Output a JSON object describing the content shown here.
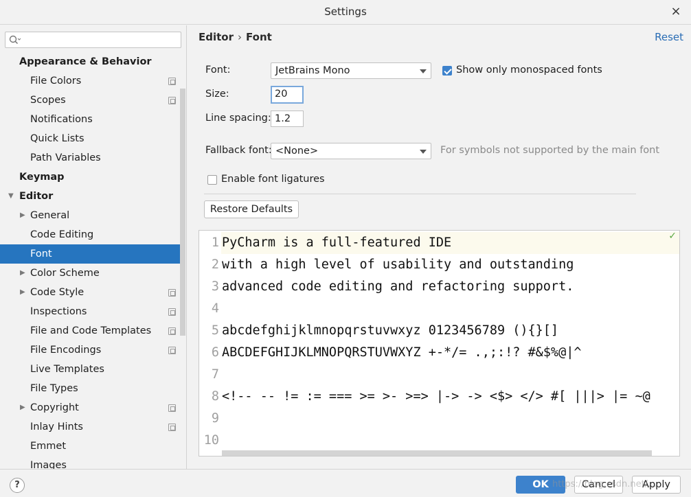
{
  "window": {
    "title": "Settings",
    "close_glyph": "×"
  },
  "sidebar": {
    "search": {
      "value": "",
      "placeholder": ""
    },
    "items": [
      {
        "label": "Appearance & Behavior",
        "level": 0,
        "bold": true,
        "arrow": "",
        "config": false
      },
      {
        "label": "File Colors",
        "level": 1,
        "bold": false,
        "arrow": "",
        "config": true
      },
      {
        "label": "Scopes",
        "level": 1,
        "bold": false,
        "arrow": "",
        "config": true
      },
      {
        "label": "Notifications",
        "level": 1,
        "bold": false,
        "arrow": "",
        "config": false
      },
      {
        "label": "Quick Lists",
        "level": 1,
        "bold": false,
        "arrow": "",
        "config": false
      },
      {
        "label": "Path Variables",
        "level": 1,
        "bold": false,
        "arrow": "",
        "config": false
      },
      {
        "label": "Keymap",
        "level": 0,
        "bold": true,
        "arrow": "",
        "config": false
      },
      {
        "label": "Editor",
        "level": 0,
        "bold": true,
        "arrow": "▼",
        "config": false
      },
      {
        "label": "General",
        "level": 1,
        "bold": false,
        "arrow": "▶",
        "config": false
      },
      {
        "label": "Code Editing",
        "level": 1,
        "bold": false,
        "arrow": "",
        "config": false
      },
      {
        "label": "Font",
        "level": 1,
        "bold": false,
        "arrow": "",
        "config": false,
        "selected": true
      },
      {
        "label": "Color Scheme",
        "level": 1,
        "bold": false,
        "arrow": "▶",
        "config": false
      },
      {
        "label": "Code Style",
        "level": 1,
        "bold": false,
        "arrow": "▶",
        "config": true
      },
      {
        "label": "Inspections",
        "level": 1,
        "bold": false,
        "arrow": "",
        "config": true
      },
      {
        "label": "File and Code Templates",
        "level": 1,
        "bold": false,
        "arrow": "",
        "config": true
      },
      {
        "label": "File Encodings",
        "level": 1,
        "bold": false,
        "arrow": "",
        "config": true
      },
      {
        "label": "Live Templates",
        "level": 1,
        "bold": false,
        "arrow": "",
        "config": false
      },
      {
        "label": "File Types",
        "level": 1,
        "bold": false,
        "arrow": "",
        "config": false
      },
      {
        "label": "Copyright",
        "level": 1,
        "bold": false,
        "arrow": "▶",
        "config": true
      },
      {
        "label": "Inlay Hints",
        "level": 1,
        "bold": false,
        "arrow": "",
        "config": true
      },
      {
        "label": "Emmet",
        "level": 1,
        "bold": false,
        "arrow": "",
        "config": false
      },
      {
        "label": "Images",
        "level": 1,
        "bold": false,
        "arrow": "",
        "config": false
      }
    ]
  },
  "header": {
    "breadcrumb_parent": "Editor",
    "breadcrumb_sep": "›",
    "breadcrumb_current": "Font",
    "reset_label": "Reset"
  },
  "form": {
    "font_label": "Font:",
    "font_value": "JetBrains Mono",
    "mono_only_label": "Show only monospaced fonts",
    "mono_only_checked": true,
    "size_label": "Size:",
    "size_value": "20",
    "line_spacing_label": "Line spacing:",
    "line_spacing_value": "1.2",
    "fallback_label": "Fallback font:",
    "fallback_value": "<None>",
    "fallback_hint": "For symbols not supported by the main font",
    "ligatures_label": "Enable font ligatures",
    "ligatures_checked": false,
    "restore_defaults_label": "Restore Defaults"
  },
  "preview": {
    "lines": [
      {
        "n": "1",
        "text": "PyCharm is a full-featured IDE"
      },
      {
        "n": "2",
        "text": "with a high level of usability and outstanding"
      },
      {
        "n": "3",
        "text": "advanced code editing and refactoring support."
      },
      {
        "n": "4",
        "text": ""
      },
      {
        "n": "5",
        "text": "abcdefghijklmnopqrstuvwxyz 0123456789 (){}[]"
      },
      {
        "n": "6",
        "text": "ABCDEFGHIJKLMNOPQRSTUVWXYZ +-*/= .,;:!? #&$%@|^"
      },
      {
        "n": "7",
        "text": ""
      },
      {
        "n": "8",
        "text": "<!-- -- != := === >= >- >=> |-> -> <$> </> #[ |||> |= ~@"
      },
      {
        "n": "9",
        "text": ""
      },
      {
        "n": "10",
        "text": ""
      }
    ],
    "status_glyph": "✓"
  },
  "footer": {
    "help_label": "?",
    "ok_label": "OK",
    "cancel_label": "Cancel",
    "apply_label": "Apply",
    "watermark": "https://blog.csdn.net/..."
  },
  "colors": {
    "selection": "#2675bf",
    "accent": "#3d82cc",
    "link": "#2a6db5",
    "current_line": "#fcfaed"
  }
}
